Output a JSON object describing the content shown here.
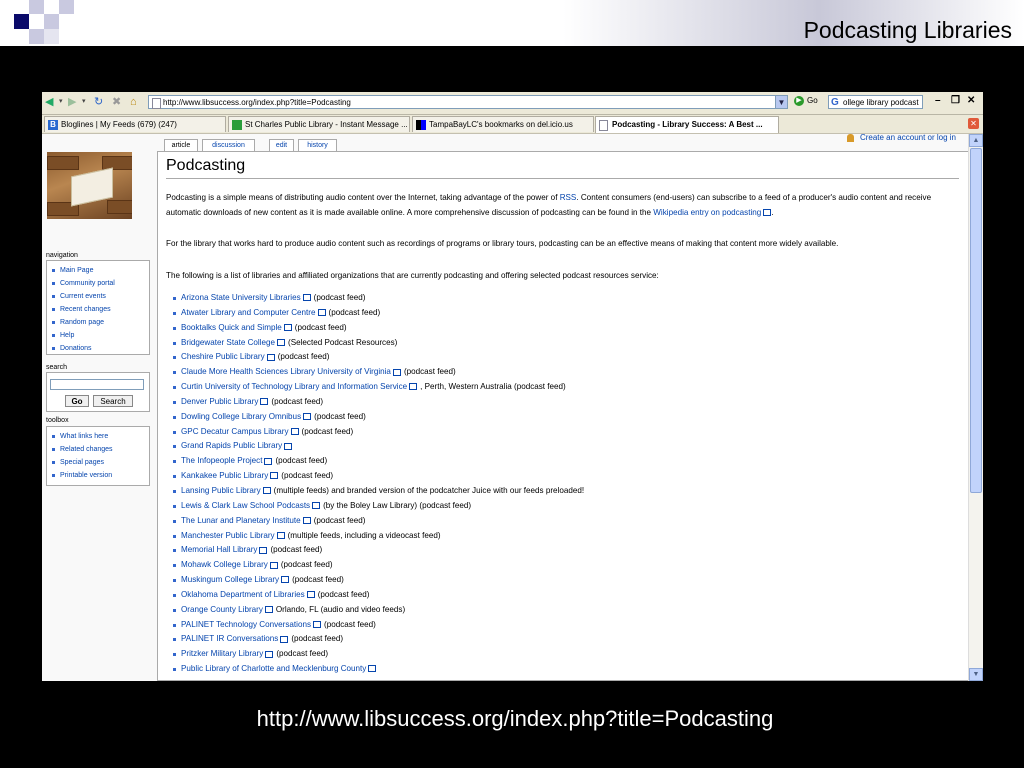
{
  "slide": {
    "title": "Podcasting Libraries",
    "caption": "http://www.libsuccess.org/index.php?title=Podcasting"
  },
  "browser": {
    "url": "http://www.libsuccess.org/index.php?title=Podcasting",
    "go_label": "Go",
    "search_value": "ollege library podcast",
    "tabs": [
      {
        "label": "Bloglines | My Feeds (679) (247)"
      },
      {
        "label": "St Charles Public Library - Instant Message ..."
      },
      {
        "label": "TampaBayLC's bookmarks on del.icio.us"
      },
      {
        "label": "Podcasting - Library Success: A Best ..."
      }
    ]
  },
  "wiki": {
    "page_tabs": [
      "article",
      "discussion",
      "edit",
      "history"
    ],
    "account_link": "Create an account or log in",
    "heading": "Podcasting",
    "sidebar": {
      "navigation_title": "navigation",
      "navigation": [
        "Main Page",
        "Community portal",
        "Current events",
        "Recent changes",
        "Random page",
        "Help",
        "Donations"
      ],
      "search_title": "search",
      "go_button": "Go",
      "search_button": "Search",
      "toolbox_title": "toolbox",
      "toolbox": [
        "What links here",
        "Related changes",
        "Special pages",
        "Printable version"
      ]
    },
    "intro": {
      "p1_a": "Podcasting is a simple means of distributing audio content over the Internet, taking advantage of the power of ",
      "p1_rss": "RSS",
      "p1_b": ". Content consumers (end-users) can subscribe to a feed of a producer's audio content and receive automatic downloads of new content as it is made available online. A more comprehensive discussion of podcasting can be found in the ",
      "p1_link": "Wikipedia entry on podcasting",
      "p1_c": ".",
      "p2": "For the library that works hard to produce audio content such as recordings of programs or library tours, podcasting can be an effective means of making that content more widely available.",
      "p3": "The following is a list of libraries and affiliated organizations that are currently podcasting and offering selected podcast resources service:"
    },
    "libraries": [
      {
        "name": "Arizona State University Libraries",
        "note": "(podcast feed)"
      },
      {
        "name": "Atwater Library and Computer Centre",
        "note": "(podcast feed)"
      },
      {
        "name": "Booktalks Quick and Simple",
        "note": "(podcast feed)"
      },
      {
        "name": "Bridgewater State College",
        "note": "(Selected Podcast Resources)"
      },
      {
        "name": "Cheshire Public Library",
        "note": "(podcast feed)"
      },
      {
        "name": "Claude More Health Sciences Library University of Virginia",
        "note": "(podcast feed)"
      },
      {
        "name": "Curtin University of Technology Library and Information Service",
        "note": ", Perth, Western Australia (podcast feed)"
      },
      {
        "name": "Denver Public Library",
        "note": "(podcast feed)"
      },
      {
        "name": "Dowling College Library Omnibus",
        "note": "(podcast feed)"
      },
      {
        "name": "GPC Decatur Campus Library",
        "note": "(podcast feed)"
      },
      {
        "name": "Grand Rapids Public Library",
        "note": ""
      },
      {
        "name": "The Infopeople Project",
        "note": "(podcast feed)"
      },
      {
        "name": "Kankakee Public Library",
        "note": "(podcast feed)"
      },
      {
        "name": "Lansing Public Library",
        "note": "(multiple feeds) and branded version of the podcatcher Juice with our feeds preloaded!"
      },
      {
        "name": "Lewis & Clark Law School Podcasts",
        "note": "(by the Boley Law Library) (podcast feed)"
      },
      {
        "name": "The Lunar and Planetary Institute",
        "note": "(podcast feed)"
      },
      {
        "name": "Manchester Public Library",
        "note": "(multiple feeds, including a videocast feed)"
      },
      {
        "name": "Memorial Hall Library",
        "note": "(podcast feed)"
      },
      {
        "name": "Mohawk College Library",
        "note": "(podcast feed)"
      },
      {
        "name": "Muskingum College Library",
        "note": "(podcast feed)"
      },
      {
        "name": "Oklahoma Department of Libraries",
        "note": "(podcast feed)"
      },
      {
        "name": "Orange County Library",
        "note": "Orlando, FL (audio and video feeds)"
      },
      {
        "name": "PALINET Technology Conversations",
        "note": "(podcast feed)"
      },
      {
        "name": "PALINET IR Conversations",
        "note": "(podcast feed)"
      },
      {
        "name": "Pritzker Military Library",
        "note": "(podcast feed)"
      },
      {
        "name": "Public Library of Charlotte and Mecklenburg County",
        "note": ""
      }
    ]
  }
}
